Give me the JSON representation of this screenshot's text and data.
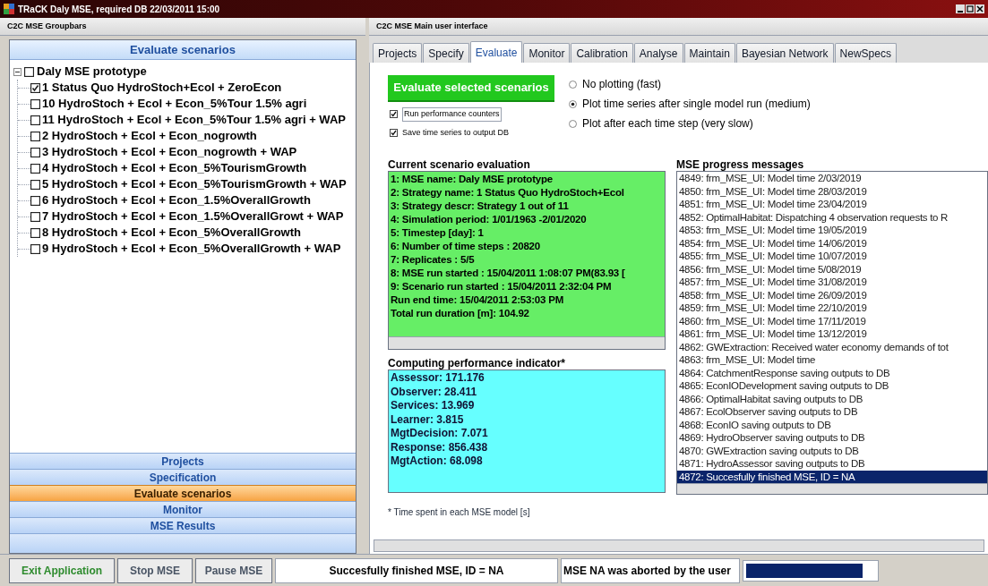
{
  "window": {
    "title": "TRaCK Daly MSE, required DB 22/03/2011 15:00"
  },
  "left_pane": {
    "title": "C2C MSE Groupbars",
    "section_header": "Evaluate scenarios",
    "tree": {
      "label": "Daly MSE prototype",
      "expanded": true,
      "checked": false,
      "children": [
        {
          "label": "1 Status Quo HydroStoch+Ecol + ZeroEcon",
          "checked": true
        },
        {
          "label": "10 HydroStoch + Ecol + Econ_5%Tour 1.5% agri",
          "checked": false
        },
        {
          "label": "11 HydroStoch + Ecol + Econ_5%Tour 1.5% agri + WAP",
          "checked": false
        },
        {
          "label": "2 HydroStoch + Ecol + Econ_nogrowth",
          "checked": false
        },
        {
          "label": "3 HydroStoch + Ecol + Econ_nogrowth + WAP",
          "checked": false
        },
        {
          "label": "4 HydroStoch + Ecol + Econ_5%TourismGrowth",
          "checked": false
        },
        {
          "label": "5 HydroStoch + Ecol + Econ_5%TourismGrowth + WAP",
          "checked": false
        },
        {
          "label": "6 HydroStoch + Ecol + Econ_1.5%OverallGrowth",
          "checked": false
        },
        {
          "label": "7 HydroStoch + Ecol + Econ_1.5%OverallGrowt + WAP",
          "checked": false
        },
        {
          "label": "8 HydroStoch + Ecol + Econ_5%OverallGrowth",
          "checked": false
        },
        {
          "label": "9 HydroStoch + Ecol + Econ_5%OverallGrowth + WAP",
          "checked": false
        }
      ]
    },
    "groups": [
      {
        "label": "Projects",
        "selected": false
      },
      {
        "label": "Specification",
        "selected": false
      },
      {
        "label": "Evaluate scenarios",
        "selected": true
      },
      {
        "label": "Monitor",
        "selected": false
      },
      {
        "label": "MSE Results",
        "selected": false
      }
    ]
  },
  "right_pane": {
    "title": "C2C MSE Main user interface",
    "tabs": [
      {
        "label": "Projects",
        "selected": false
      },
      {
        "label": "Specify",
        "selected": false
      },
      {
        "label": "Evaluate",
        "selected": true
      },
      {
        "label": "Monitor",
        "selected": false
      },
      {
        "label": "Calibration",
        "selected": false
      },
      {
        "label": "Analyse",
        "selected": false
      },
      {
        "label": "Maintain",
        "selected": false
      },
      {
        "label": "Bayesian Network",
        "selected": false
      },
      {
        "label": "NewSpecs",
        "selected": false
      }
    ],
    "evaluate_button": "Evaluate selected scenarios",
    "options": [
      {
        "label": "Run performance counters",
        "checked": true
      },
      {
        "label": "Save time series to output DB",
        "checked": true
      }
    ],
    "plot_modes": [
      {
        "label": "No plotting (fast)",
        "selected": false
      },
      {
        "label": "Plot time series after single model run (medium)",
        "selected": true
      },
      {
        "label": "Plot after each time step (very slow)",
        "selected": false
      }
    ],
    "current_scenario": {
      "title": "Current scenario evaluation",
      "lines": [
        "1: MSE name: Daly MSE prototype",
        "2: Strategy name: 1 Status Quo HydroStoch+Ecol",
        "3: Strategy descr: Strategy 1 out of 11",
        "4: Simulation period: 1/01/1963 -2/01/2020",
        "5: Timestep [day]: 1",
        "6: Number of time steps : 20820",
        "7: Replicates : 5/5",
        "8: MSE run started : 15/04/2011 1:08:07 PM(83.93 [",
        "9: Scenario run started : 15/04/2011 2:32:04 PM",
        "Run end time: 15/04/2011 2:53:03 PM",
        "Total run duration [m]: 104.92"
      ]
    },
    "performance": {
      "title": "Computing performance indicator*",
      "lines": [
        "Assessor: 171.176",
        "Observer: 28.411",
        "Services: 13.969",
        "Learner: 3.815",
        "MgtDecision: 7.071",
        "Response: 856.438",
        "MgtAction: 68.098"
      ]
    },
    "footnote": "* Time spent in each MSE model [s]",
    "messages": {
      "title": "MSE progress messages",
      "items": [
        {
          "text": "4849: frm_MSE_UI: Model time 2/03/2019",
          "selected": false
        },
        {
          "text": "4850: frm_MSE_UI: Model time 28/03/2019",
          "selected": false
        },
        {
          "text": "4851: frm_MSE_UI: Model time 23/04/2019",
          "selected": false
        },
        {
          "text": "4852: OptimalHabitat: Dispatching 4 observation requests to R",
          "selected": false
        },
        {
          "text": "4853: frm_MSE_UI: Model time 19/05/2019",
          "selected": false
        },
        {
          "text": "4854: frm_MSE_UI: Model time 14/06/2019",
          "selected": false
        },
        {
          "text": "4855: frm_MSE_UI: Model time 10/07/2019",
          "selected": false
        },
        {
          "text": "4856: frm_MSE_UI: Model time 5/08/2019",
          "selected": false
        },
        {
          "text": "4857: frm_MSE_UI: Model time 31/08/2019",
          "selected": false
        },
        {
          "text": "4858: frm_MSE_UI: Model time 26/09/2019",
          "selected": false
        },
        {
          "text": "4859: frm_MSE_UI: Model time 22/10/2019",
          "selected": false
        },
        {
          "text": "4860: frm_MSE_UI: Model time 17/11/2019",
          "selected": false
        },
        {
          "text": "4861: frm_MSE_UI: Model time 13/12/2019",
          "selected": false
        },
        {
          "text": "4862: GWExtraction: Received water economy demands of tot",
          "selected": false
        },
        {
          "text": "4863: frm_MSE_UI: Model time",
          "selected": false
        },
        {
          "text": "4864: CatchmentResponse saving outputs to DB",
          "selected": false
        },
        {
          "text": "4865: EconIODevelopment saving outputs to DB",
          "selected": false
        },
        {
          "text": "4866: OptimalHabitat saving outputs to DB",
          "selected": false
        },
        {
          "text": "4867: EcolObserver saving outputs to DB",
          "selected": false
        },
        {
          "text": "4868: EconIO saving outputs to DB",
          "selected": false
        },
        {
          "text": "4869: HydroObserver saving outputs to DB",
          "selected": false
        },
        {
          "text": "4870: GWExtraction saving outputs to DB",
          "selected": false
        },
        {
          "text": "4871: HydroAssessor saving outputs to DB",
          "selected": false
        },
        {
          "text": "4872: Succesfully finished MSE, ID = NA",
          "selected": true
        }
      ]
    }
  },
  "status_bar": {
    "buttons": [
      {
        "label": "Exit Application",
        "kind": "exit"
      },
      {
        "label": "Stop MSE",
        "kind": "normal"
      },
      {
        "label": "Pause MSE",
        "kind": "normal"
      }
    ],
    "status": "Succesfully finished MSE, ID = NA",
    "message": "MSE NA was aborted by the user",
    "progress": {
      "level": 0.9
    }
  }
}
